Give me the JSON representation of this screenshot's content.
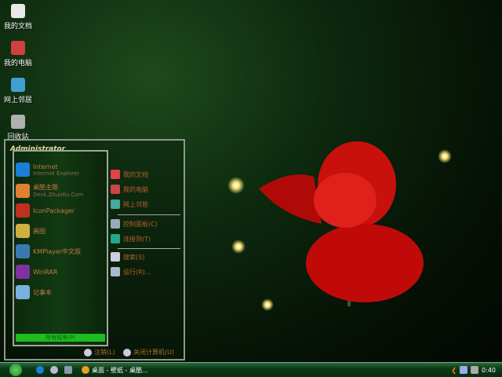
{
  "desktop_icons": [
    {
      "label": "我的文档",
      "icon": "documents-icon"
    },
    {
      "label": "我的电脑",
      "icon": "computer-icon"
    },
    {
      "label": "网上邻居",
      "icon": "network-icon"
    },
    {
      "label": "回收站",
      "icon": "recycle-bin-icon"
    }
  ],
  "start_menu": {
    "user": "Administrator",
    "left_items": [
      {
        "line1": "Internet",
        "line2": "Internet Explorer",
        "icon": "ie-icon",
        "color": "#1a7fd8"
      },
      {
        "line1": "桌酷主题",
        "line2": "Desk.ZhuoKu.Com",
        "icon": "zhuoku-icon",
        "color": "#e08030"
      },
      {
        "line1": "IconPackager",
        "line2": "",
        "icon": "iconpackager-icon",
        "color": "#c03020"
      },
      {
        "line1": "画图",
        "line2": "",
        "icon": "paint-icon",
        "color": "#d0b040"
      },
      {
        "line1": "KMPlayer中文版",
        "line2": "",
        "icon": "kmplayer-icon",
        "color": "#3a7ab0"
      },
      {
        "line1": "WinRAR",
        "line2": "",
        "icon": "winrar-icon",
        "color": "#8030a0"
      },
      {
        "line1": "记事本",
        "line2": "",
        "icon": "notepad-icon",
        "color": "#7ab0e0"
      }
    ],
    "all_programs": "所有程序(P)",
    "right_items": [
      {
        "label": "我的文档",
        "icon": "documents-icon"
      },
      {
        "label": "我的电脑",
        "icon": "computer-icon"
      },
      {
        "label": "网上邻居",
        "icon": "network-icon"
      },
      {
        "label": "控制面板(C)",
        "icon": "control-panel-icon"
      },
      {
        "label": "连接到(T)",
        "icon": "connect-icon"
      },
      {
        "label": "搜索(S)",
        "icon": "search-icon"
      },
      {
        "label": "运行(R)...",
        "icon": "run-icon"
      }
    ],
    "logoff": "注销(L)",
    "shutdown": "关闭计算机(U)"
  },
  "taskbar": {
    "task": "桌面 - 壁纸 - 桌酷...",
    "clock": "0:40"
  }
}
